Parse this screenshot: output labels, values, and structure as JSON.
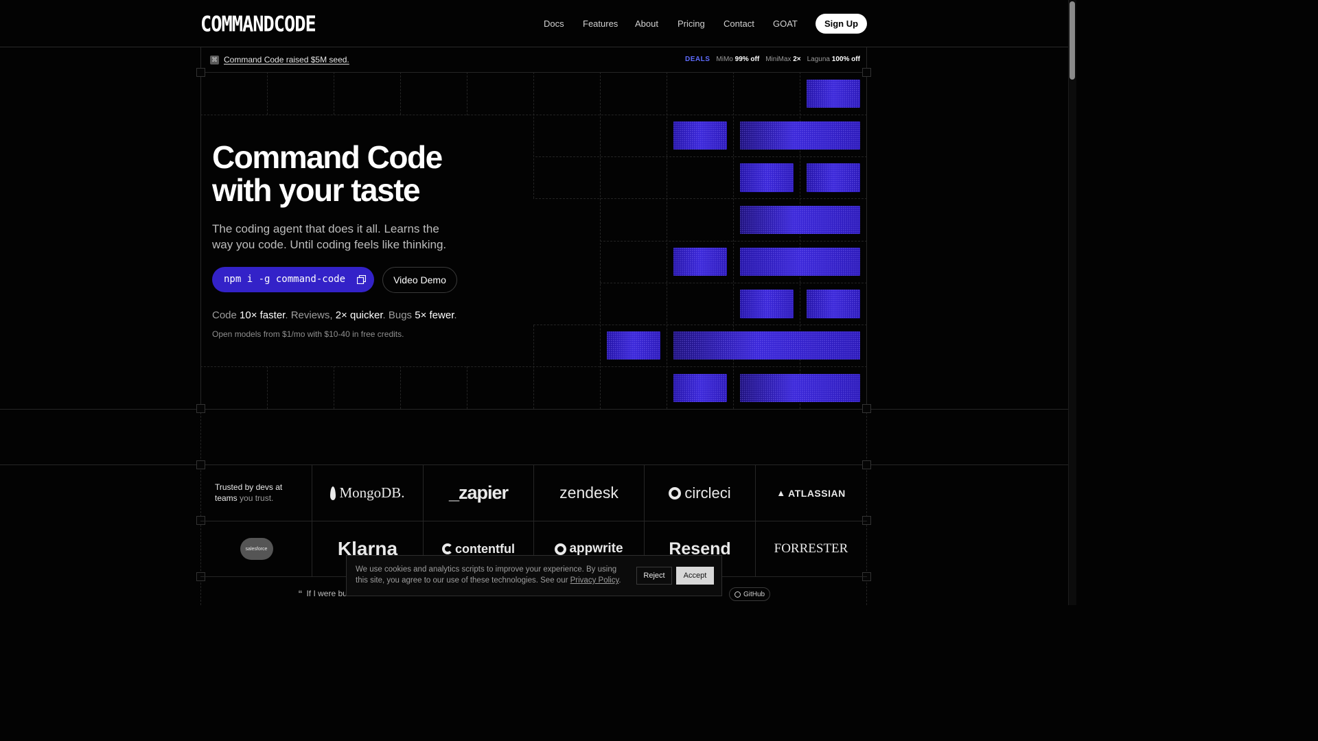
{
  "header": {
    "logo_text": "COMMANDCODE",
    "nav": [
      "Docs",
      "Features",
      "About",
      "Pricing",
      "Contact",
      "GOAT"
    ],
    "signup_label": "Sign Up"
  },
  "announcement": {
    "text": "Command Code raised $5M seed."
  },
  "deals": {
    "label": "DEALS",
    "items": [
      {
        "name": "MiMo",
        "value": "99% off"
      },
      {
        "name": "MiniMax",
        "value": "2×"
      },
      {
        "name": "Laguna",
        "value": "100% off"
      }
    ]
  },
  "hero": {
    "title_line1": "Command Code",
    "title_line2": "with your taste",
    "subtitle": "The coding agent that does it all. Learns the way you code. Until coding feels like thinking.",
    "install_command": "npm i -g command-code",
    "video_label": "Video Demo",
    "stats": {
      "a_label": "Code",
      "a_value": "10× faster",
      "b_label": "Reviews,",
      "b_value": "2× quicker",
      "c_label": "Bugs",
      "c_value": "5× fewer"
    },
    "fine_print": "Open models from $1/mo with $10-40 in free credits."
  },
  "trusted": {
    "line1": "Trusted by devs at",
    "line2a": "teams",
    "line2b": "you trust."
  },
  "logos_row1": [
    "MongoDB.",
    "_zapier",
    "zendesk",
    "circleci",
    "ATLASSIAN"
  ],
  "logos_row2": [
    "salesforce",
    "Klarna",
    "contentful",
    "appwrite",
    "Resend",
    "FORRESTER"
  ],
  "cookie": {
    "text": "We use cookies and analytics scripts to improve your experience. By using this site, you agree to our use of these technologies. See our",
    "link": "Privacy Policy",
    "reject": "Reject",
    "accept": "Accept"
  },
  "quote_text": "If I were bu",
  "github_label": "GitHub"
}
